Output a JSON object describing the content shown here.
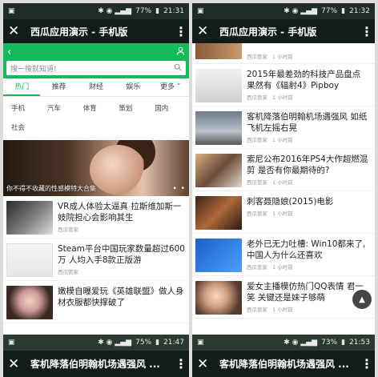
{
  "left": {
    "status": {
      "battery": "77%",
      "time": "21:31"
    },
    "title": "西瓜应用演示 - 手机版",
    "search_placeholder": "搜一搜就知道!",
    "tabs": [
      "热门",
      "推荐",
      "财经",
      "娱乐",
      "更多"
    ],
    "categories_row1": [
      "手机",
      "汽车",
      "体育",
      "策划",
      "国内"
    ],
    "categories_row2": [
      "社会"
    ],
    "hero_caption": "你不得不收藏的性感模特大合集",
    "news": [
      {
        "title": "VR成人体验太逼真 拉斯维加斯一妓院担心会影响其生",
        "meta": "西瓜管家"
      },
      {
        "title": "Steam平台中国玩家数量超过600万 人均入手8款正版游",
        "meta": "西瓜管家"
      },
      {
        "title": "嫩模自曝爱玩《英雄联盟》做人身材衣服都快撑破了",
        "meta": ""
      }
    ]
  },
  "right": {
    "status": {
      "battery": "77%",
      "time": "21:32"
    },
    "title": "西瓜应用演示 - 手机版",
    "news": [
      {
        "title": "",
        "meta": "西瓜管家",
        "ago": "1 小时前"
      },
      {
        "title": "2015年最差劲的科技产品盘点 果然有《辐射4》Pipboy",
        "meta": "西瓜管家",
        "ago": "1 小时前"
      },
      {
        "title": "客机降落伯明翰机场遇强风 如纸飞机左摇右晃",
        "meta": "西瓜管家",
        "ago": "1 小时前"
      },
      {
        "title": "索尼公布2016年PS4大作超燃混剪 是否有你最期待的?",
        "meta": "西瓜管家",
        "ago": "1 小时前"
      },
      {
        "title": "刺客聂隐娘(2015)电影",
        "meta": "西瓜管家",
        "ago": "1 小时前"
      },
      {
        "title": "老外已无力吐槽: Win10都来了, 中国人为什么还喜欢",
        "meta": "西瓜管家",
        "ago": "1 小时前"
      },
      {
        "title": "爱女主播模仿热门QQ表情 君一笑 关键还是妹子够萌",
        "meta": "西瓜管家",
        "ago": "1 小时前"
      }
    ]
  },
  "bottom_left": {
    "status": {
      "battery": "75%",
      "time": "21:47"
    },
    "title": "客机降落伯明翰机场遇强风 ..."
  },
  "bottom_right": {
    "status": {
      "battery": "73%",
      "time": "21:53"
    },
    "title": "客机降落伯明翰机场遇强风 ..."
  },
  "colors": {
    "accent": "#18b95a",
    "titlebar": "#121d17"
  }
}
